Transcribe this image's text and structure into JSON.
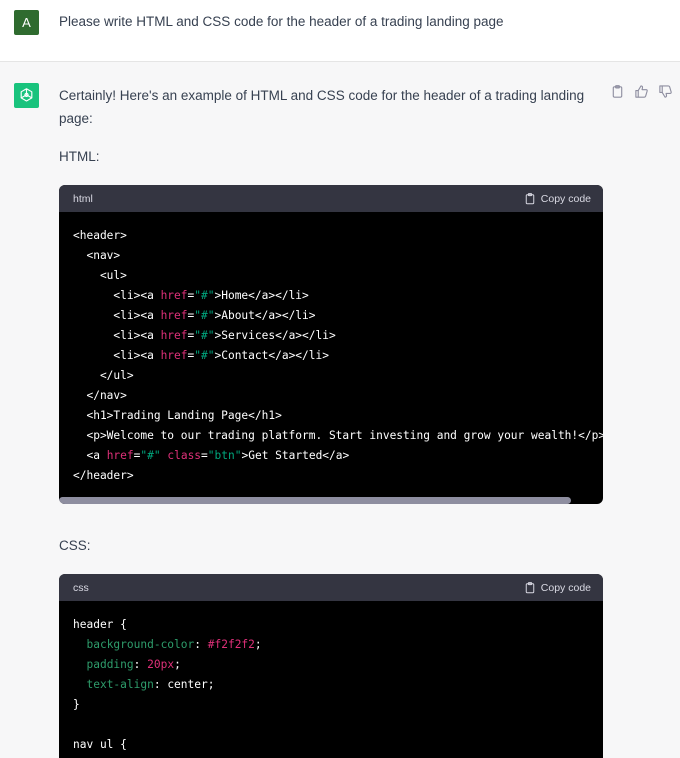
{
  "user": {
    "avatar_letter": "A",
    "avatar_color": "#2f6b2f",
    "message": "Please write HTML and CSS code for the header of a trading landing page"
  },
  "assistant": {
    "avatar_color": "#19c37d",
    "intro": "Certainly! Here's an example of HTML and CSS code for the header of a trading landing page:",
    "html_label": "HTML:",
    "css_label": "CSS:",
    "actions": [
      "clipboard-icon",
      "thumbs-up-icon",
      "thumbs-down-icon"
    ]
  },
  "html_block": {
    "lang": "html",
    "copy_label": "Copy code",
    "lines": [
      "<header>",
      "  <nav>",
      "    <ul>",
      "      <li><a href=\"#\">Home</a></li>",
      "      <li><a href=\"#\">About</a></li>",
      "      <li><a href=\"#\">Services</a></li>",
      "      <li><a href=\"#\">Contact</a></li>",
      "    </ul>",
      "  </nav>",
      "  <h1>Trading Landing Page</h1>",
      "  <p>Welcome to our trading platform. Start investing and grow your wealth!</p>",
      "  <a href=\"#\" class=\"btn\">Get Started</a>",
      "</header>"
    ]
  },
  "css_block": {
    "lang": "css",
    "copy_label": "Copy code",
    "lines": [
      "header {",
      "  background-color: #f2f2f2;",
      "  padding: 20px;",
      "  text-align: center;",
      "}",
      "",
      "nav ul {"
    ]
  }
}
